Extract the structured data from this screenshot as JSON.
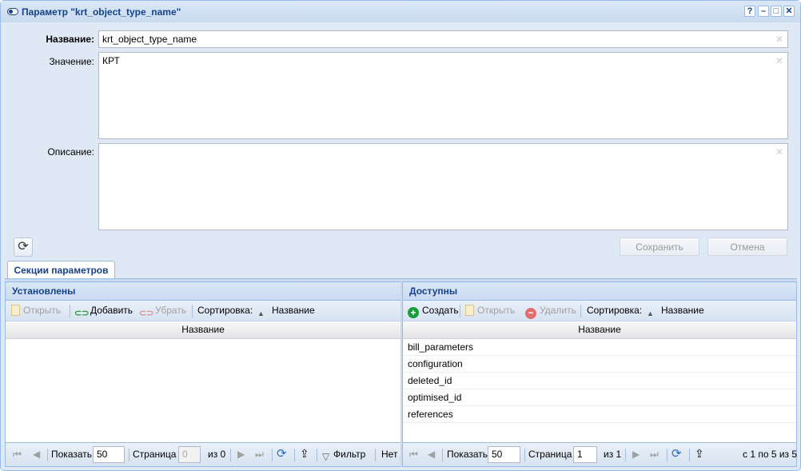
{
  "window": {
    "title": "Параметр \"krt_object_type_name\"",
    "buttons": {
      "help": "?",
      "minimize": "–",
      "maximize": "□",
      "close": "✕"
    }
  },
  "form": {
    "name_label": "Название:",
    "name_value": "krt_object_type_name",
    "value_label": "Значение:",
    "value_value": "КРТ",
    "desc_label": "Описание:",
    "desc_value": "",
    "clear_glyph": "✕",
    "save_label": "Сохранить",
    "cancel_label": "Отмена"
  },
  "tabs": [
    {
      "label": "Секции параметров"
    }
  ],
  "left": {
    "title": "Установлены",
    "toolbar": {
      "open": "Открыть",
      "add": "Добавить",
      "remove": "Убрать",
      "sort": "Сортировка:",
      "sort_field": "Название"
    },
    "column": "Название",
    "rows": [],
    "paging": {
      "show": "Показать",
      "page_size": "50",
      "page": "Страница",
      "page_value": "0",
      "of": "из 0",
      "filter": "Фильтр",
      "empty": "Нет д"
    }
  },
  "right": {
    "title": "Доступны",
    "toolbar": {
      "create": "Создать",
      "open": "Открыть",
      "delete": "Удалить",
      "sort": "Сортировка:",
      "sort_field": "Название"
    },
    "column": "Название",
    "rows": [
      "bill_parameters",
      "configuration",
      "deleted_id",
      "optimised_id",
      "references"
    ],
    "paging": {
      "show": "Показать",
      "page_size": "50",
      "page": "Страница",
      "page_value": "1",
      "of": "из 1",
      "range": "с 1 по 5 из 5"
    }
  },
  "colors": {
    "header": "#15428b",
    "border": "#99bbe8",
    "create": "#1a9c3a",
    "delete": "#e07070"
  }
}
